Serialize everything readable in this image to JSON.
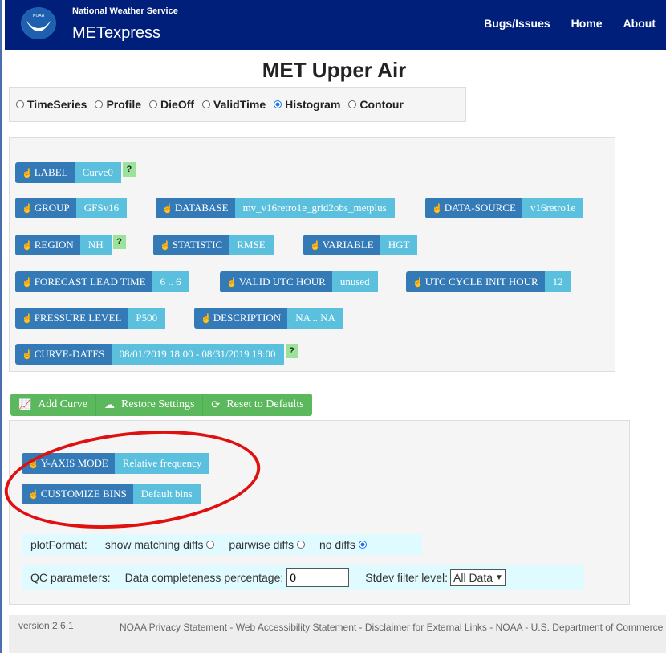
{
  "header": {
    "org": "National Weather Service",
    "app": "METexpress",
    "logo_text": "NOAA",
    "nav": [
      "Bugs/Issues",
      "Home",
      "About"
    ]
  },
  "page_title": "MET Upper Air",
  "plot_types": {
    "items": [
      "TimeSeries",
      "Profile",
      "DieOff",
      "ValidTime",
      "Histogram",
      "Contour"
    ],
    "selected": "Histogram"
  },
  "curve_params": {
    "label": {
      "name": "LABEL",
      "value": "Curve0",
      "help": "?"
    },
    "group": {
      "name": "GROUP",
      "value": "GFSv16"
    },
    "database": {
      "name": "DATABASE",
      "value": "mv_v16retro1e_grid2obs_metplus"
    },
    "data_source": {
      "name": "DATA-SOURCE",
      "value": "v16retro1e"
    },
    "region": {
      "name": "REGION",
      "value": "NH",
      "help": "?"
    },
    "statistic": {
      "name": "STATISTIC",
      "value": "RMSE"
    },
    "variable": {
      "name": "VARIABLE",
      "value": "HGT"
    },
    "forecast_lead": {
      "name": "FORECAST LEAD TIME",
      "value": "6 .. 6"
    },
    "valid_utc": {
      "name": "VALID UTC HOUR",
      "value": "unused"
    },
    "utc_cycle": {
      "name": "UTC CYCLE INIT HOUR",
      "value": "12"
    },
    "pressure": {
      "name": "PRESSURE LEVEL",
      "value": "P500"
    },
    "description": {
      "name": "DESCRIPTION",
      "value": "NA .. NA"
    },
    "curve_dates": {
      "name": "CURVE-DATES",
      "value": "08/01/2019 18:00 - 08/31/2019 18:00",
      "help": "?"
    }
  },
  "actions": {
    "add_curve": "Add Curve",
    "restore": "Restore Settings",
    "reset": "Reset to Defaults"
  },
  "options": {
    "y_axis_mode": {
      "name": "Y-AXIS MODE",
      "value": "Relative frequency"
    },
    "customize_bins": {
      "name": "CUSTOMIZE BINS",
      "value": "Default bins"
    },
    "plot_format": {
      "label": "plotFormat:",
      "choices": [
        "show matching diffs",
        "pairwise diffs",
        "no diffs"
      ],
      "selected": "no diffs"
    },
    "qc": {
      "label": "QC parameters:",
      "completeness_label": "Data completeness percentage:",
      "completeness_value": "0",
      "stdev_label": "Stdev filter level:",
      "stdev_value": "All Data"
    }
  },
  "footer": {
    "version": "version 2.6.1",
    "links": "NOAA Privacy Statement - Web Accessibility Statement - Disclaimer for External Links - NOAA - U.S. Department of Commerce"
  },
  "colors": {
    "navbar": "#001f7a",
    "param_name": "#337ab7",
    "param_value": "#5bc0de",
    "action_green": "#5cb85c",
    "annotation_red": "#e01010"
  }
}
